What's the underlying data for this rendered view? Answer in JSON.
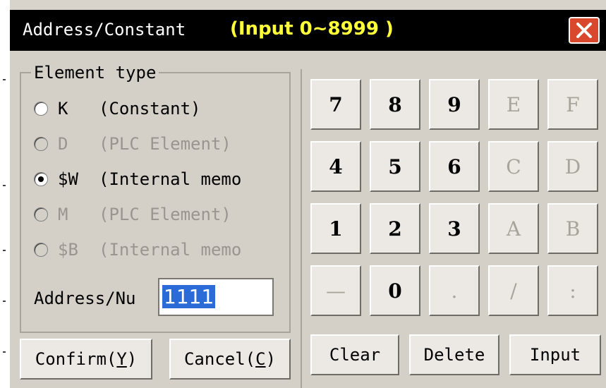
{
  "title": {
    "text": "Address/Constant",
    "range": "(Input 0~8999 )"
  },
  "element_type": {
    "legend": "Element type",
    "options": [
      {
        "code": "K",
        "desc": "(Constant)",
        "checked": false,
        "enabled": true
      },
      {
        "code": "D",
        "desc": "(PLC Element)",
        "checked": false,
        "enabled": false
      },
      {
        "code": "$W",
        "desc": "(Internal memo",
        "checked": true,
        "enabled": true
      },
      {
        "code": "M",
        "desc": "(PLC Element)",
        "checked": false,
        "enabled": false
      },
      {
        "code": "$B",
        "desc": "(Internal memo",
        "checked": false,
        "enabled": false
      }
    ]
  },
  "address": {
    "label": "Address/Nu",
    "value": "1111"
  },
  "keypad": {
    "k7": "7",
    "k8": "8",
    "k9": "9",
    "kE": "E",
    "kF": "F",
    "k4": "4",
    "k5": "5",
    "k6": "6",
    "kC": "C",
    "kD": "D",
    "k1": "1",
    "k2": "2",
    "k3": "3",
    "kA": "A",
    "kB": "B",
    "kminus": "—",
    "k0": "0",
    "kdot": ".",
    "kslash": "/",
    "kcolon": ":"
  },
  "buttons": {
    "confirm": "Confirm(",
    "confirm_key": "Y",
    "cancel": "Cancel(",
    "cancel_key": "C",
    "close_paren": ")",
    "clear": "Clear",
    "delete": "Delete",
    "input": "Input"
  },
  "colors": {
    "title_bg": "#000000",
    "range_text": "#ffff3a",
    "close_bg": "#d9482c",
    "selection": "#2a6bd8"
  },
  "icons": {
    "close": "close-icon"
  }
}
